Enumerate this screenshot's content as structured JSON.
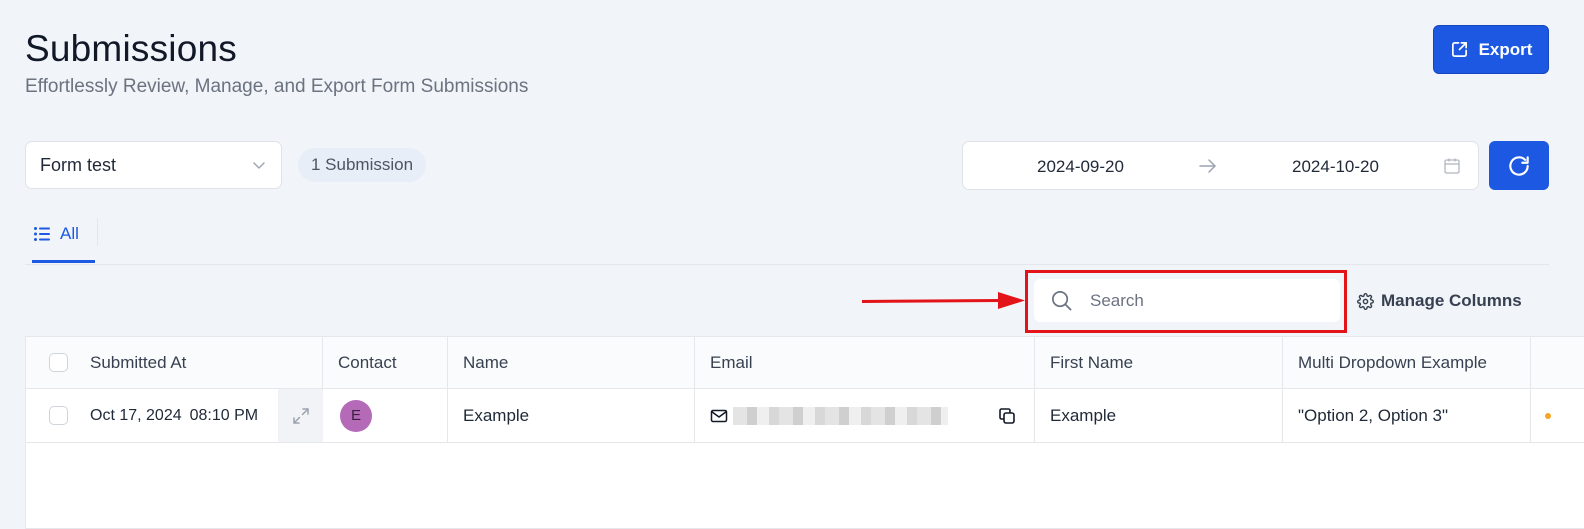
{
  "header": {
    "title": "Submissions",
    "subtitle": "Effortlessly Review, Manage, and Export Form Submissions",
    "export_label": "Export"
  },
  "filters": {
    "form_select_value": "Form test",
    "submission_count": "1 Submission",
    "date_start": "2024-09-20",
    "date_end": "2024-10-20"
  },
  "tabs": [
    {
      "label": "All",
      "active": true
    }
  ],
  "toolbar": {
    "search_placeholder": "Search",
    "manage_columns_label": "Manage Columns"
  },
  "table": {
    "columns": [
      "Submitted At",
      "Contact",
      "Name",
      "Email",
      "First Name",
      "Multi Dropdown Example"
    ],
    "rows": [
      {
        "submitted_date": "Oct 17, 2024",
        "submitted_time": "08:10 PM",
        "contact_initial": "E",
        "name": "Example",
        "first_name": "Example",
        "multi_dropdown": "\"Option 2, Option 3\""
      }
    ]
  },
  "colors": {
    "primary": "#1d58e2",
    "highlight": "#e2141a",
    "avatar": "#b56ab8",
    "background": "#f1f4f8"
  },
  "icons": [
    "export-icon",
    "chevron-down-icon",
    "arrow-right-icon",
    "calendar-icon",
    "refresh-icon",
    "list-icon",
    "search-icon",
    "gear-icon",
    "expand-icon",
    "mail-icon",
    "copy-icon"
  ]
}
